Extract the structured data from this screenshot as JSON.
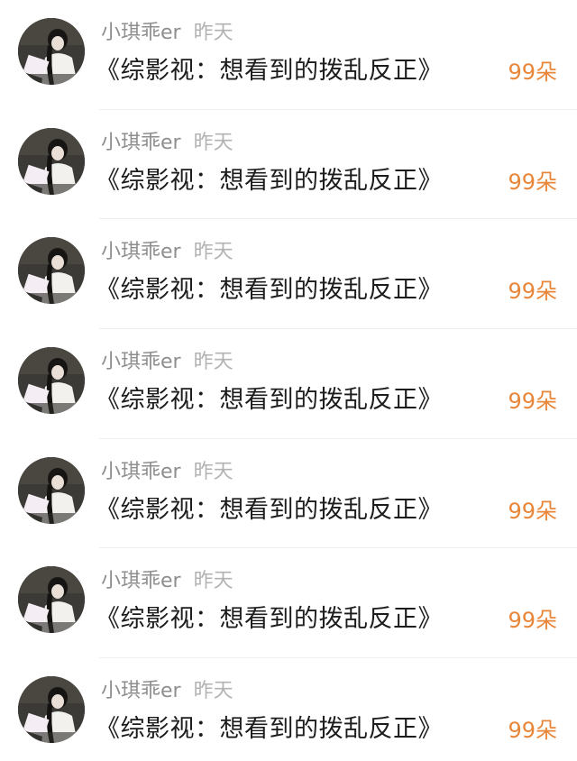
{
  "items": [
    {
      "username": "小琪乖er",
      "time": "昨天",
      "title": "《综影视：想看到的拨乱反正》",
      "count": "99朵",
      "avatar_icon": "user-avatar"
    },
    {
      "username": "小琪乖er",
      "time": "昨天",
      "title": "《综影视：想看到的拨乱反正》",
      "count": "99朵",
      "avatar_icon": "user-avatar"
    },
    {
      "username": "小琪乖er",
      "time": "昨天",
      "title": "《综影视：想看到的拨乱反正》",
      "count": "99朵",
      "avatar_icon": "user-avatar"
    },
    {
      "username": "小琪乖er",
      "time": "昨天",
      "title": "《综影视：想看到的拨乱反正》",
      "count": "99朵",
      "avatar_icon": "user-avatar"
    },
    {
      "username": "小琪乖er",
      "time": "昨天",
      "title": "《综影视：想看到的拨乱反正》",
      "count": "99朵",
      "avatar_icon": "user-avatar"
    },
    {
      "username": "小琪乖er",
      "time": "昨天",
      "title": "《综影视：想看到的拨乱反正》",
      "count": "99朵",
      "avatar_icon": "user-avatar"
    },
    {
      "username": "小琪乖er",
      "time": "昨天",
      "title": "《综影视：想看到的拨乱反正》",
      "count": "99朵",
      "avatar_icon": "user-avatar"
    }
  ],
  "colors": {
    "count": "#e8863a",
    "username": "#8e8e8e",
    "time": "#b3b3b3",
    "title": "#1c1c1c"
  }
}
